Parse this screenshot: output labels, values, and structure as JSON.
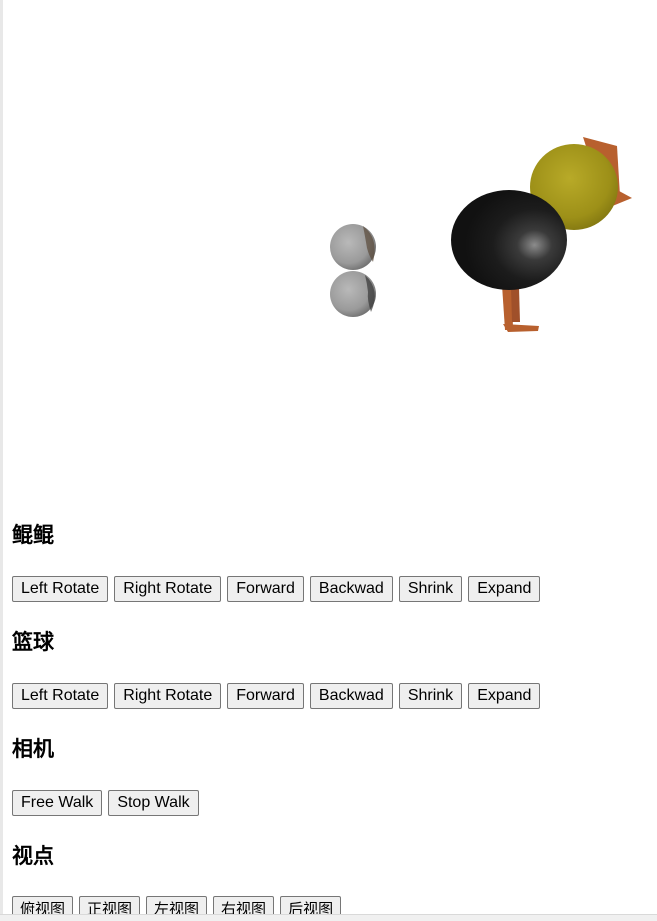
{
  "sections": [
    {
      "title": "鲲鲲",
      "buttons": [
        "Left Rotate",
        "Right Rotate",
        "Forward",
        "Backwad",
        "Shrink",
        "Expand"
      ]
    },
    {
      "title": "篮球",
      "buttons": [
        "Left Rotate",
        "Right Rotate",
        "Forward",
        "Backwad",
        "Shrink",
        "Expand"
      ]
    },
    {
      "title": "相机",
      "buttons": [
        "Free Walk",
        "Stop Walk"
      ]
    },
    {
      "title": "视点",
      "buttons": [
        "俯视图",
        "正视图",
        "左视图",
        "右视图",
        "后视图"
      ]
    }
  ],
  "colors": {
    "chicken_body": "#1b1b1b",
    "chicken_head": "#a7991d",
    "beak_legs": "#b8602e",
    "ball": "#9a9a9a",
    "button_bg": "#efefef",
    "button_border": "#767676"
  }
}
